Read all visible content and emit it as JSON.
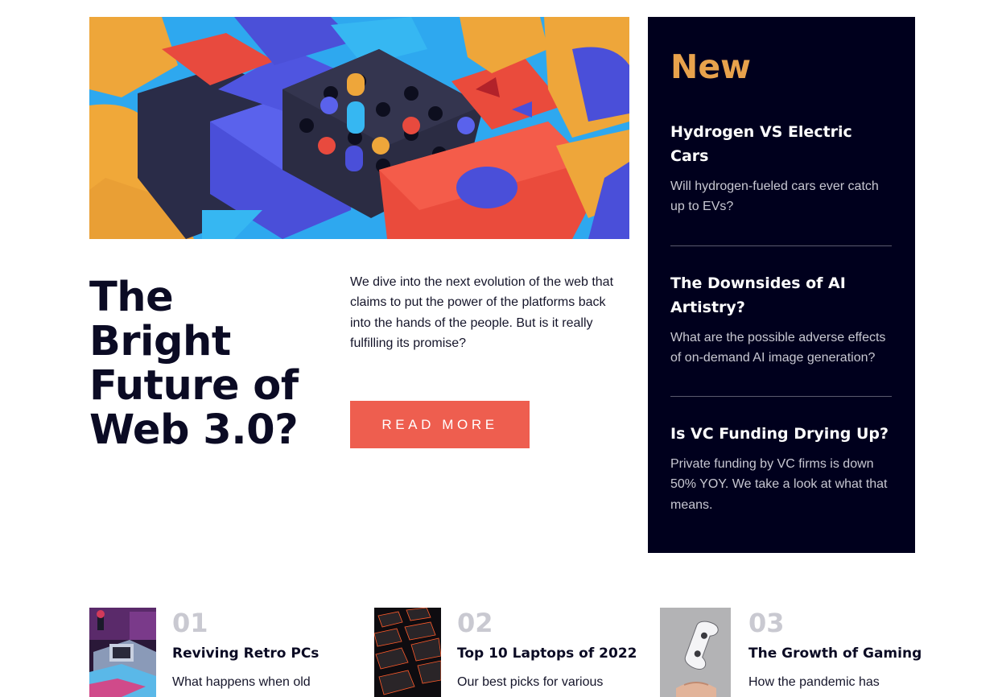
{
  "featured": {
    "image_alt": "Abstract colorful 3D blocks",
    "title_lines": [
      "The",
      "Bright",
      "Future of",
      "Web 3.0?"
    ],
    "intro": "We dive into the next evolution of the web that claims to put the power of the platforms back into the hands of the people. But is it really fulfilling its promise?",
    "button_label": "READ MORE",
    "button_color": "#ee5e4f"
  },
  "sidebar": {
    "heading": "New",
    "heading_color": "#e8a24c",
    "background": "#00001d",
    "items": [
      {
        "title": "Hydrogen VS Electric Cars",
        "summary": "Will hydrogen-fueled cars ever catch up to EVs?"
      },
      {
        "title": "The Downsides of AI Artistry?",
        "summary": "What are the possible adverse effects of on-demand AI image generation?"
      },
      {
        "title": "Is VC Funding Drying Up?",
        "summary": "Private funding by VC firms is down 50% YOY. We take a look at what that means."
      }
    ]
  },
  "top_list": [
    {
      "number": "01",
      "title": "Reviving Retro PCs",
      "summary": "What happens when old",
      "thumb_icon": "retro-pc-photo"
    },
    {
      "number": "02",
      "title": "Top 10 Laptops of 2022",
      "summary": "Our best picks for various",
      "thumb_icon": "laptop-keyboard-photo"
    },
    {
      "number": "03",
      "title": "The Growth of Gaming",
      "summary": "How the pandemic has",
      "thumb_icon": "game-controller-photo"
    }
  ]
}
